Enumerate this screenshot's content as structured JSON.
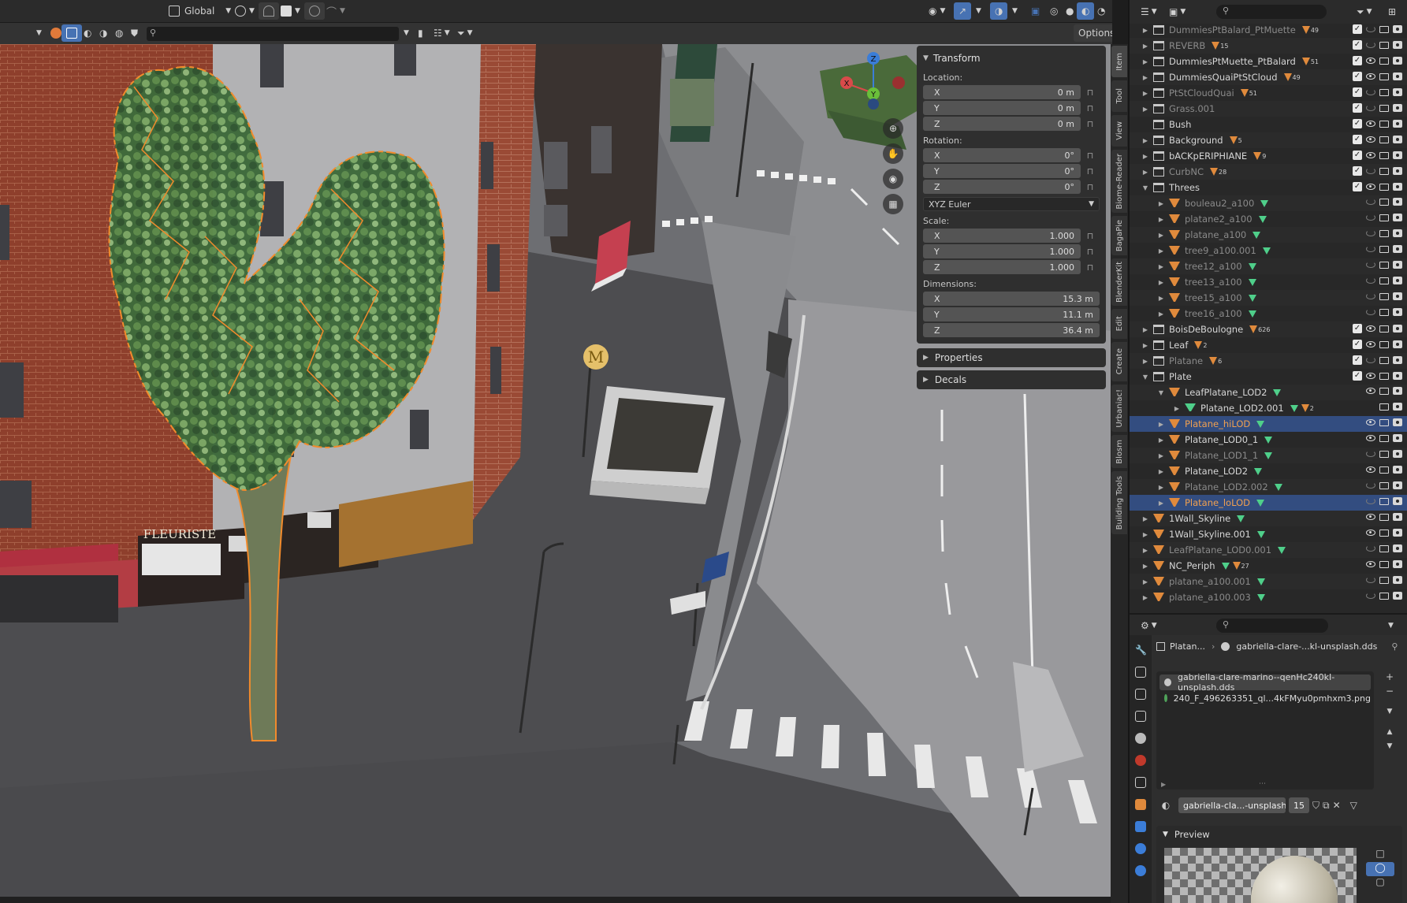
{
  "viewport_header": {
    "transform_orientation": "Global",
    "options_label": "Options"
  },
  "sign": {
    "fleuriste": "FLEURISTE",
    "metro": "M"
  },
  "gizmo": {
    "x": "X",
    "y": "Y",
    "z": "Z"
  },
  "npanel": {
    "transform_title": "Transform",
    "location_label": "Location:",
    "location": [
      {
        "axis": "X",
        "value": "0 m"
      },
      {
        "axis": "Y",
        "value": "0 m"
      },
      {
        "axis": "Z",
        "value": "0 m"
      }
    ],
    "rotation_label": "Rotation:",
    "rotation": [
      {
        "axis": "X",
        "value": "0°"
      },
      {
        "axis": "Y",
        "value": "0°"
      },
      {
        "axis": "Z",
        "value": "0°"
      }
    ],
    "rotation_mode": "XYZ Euler",
    "scale_label": "Scale:",
    "scale": [
      {
        "axis": "X",
        "value": "1.000"
      },
      {
        "axis": "Y",
        "value": "1.000"
      },
      {
        "axis": "Z",
        "value": "1.000"
      }
    ],
    "dimensions_label": "Dimensions:",
    "dimensions": [
      {
        "axis": "X",
        "value": "15.3 m"
      },
      {
        "axis": "Y",
        "value": "11.1 m"
      },
      {
        "axis": "Z",
        "value": "36.4 m"
      }
    ],
    "properties_title": "Properties",
    "decals_title": "Decals"
  },
  "sidebar_tabs": [
    "Item",
    "Tool",
    "View",
    "Biome-Reader",
    "BagaPie",
    "BlenderKit",
    "Edit",
    "Create",
    "Urbaniac!",
    "Blosm",
    "Building Tools"
  ],
  "outliner": {
    "rows": [
      {
        "name": "DummiesPtBalard_PtMuette",
        "badge": "49",
        "indent": 0,
        "icon": "collection",
        "dim": true,
        "check": true,
        "eye": false
      },
      {
        "name": "REVERB",
        "badge": "15",
        "indent": 0,
        "icon": "collection",
        "dim": true,
        "check": true,
        "eye": false
      },
      {
        "name": "DummiesPtMuette_PtBalard",
        "badge": "51",
        "indent": 0,
        "icon": "collection",
        "check": true,
        "eye": true
      },
      {
        "name": "DummiesQuaiPtStCloud",
        "badge": "49",
        "indent": 0,
        "icon": "collection",
        "check": true,
        "eye": true
      },
      {
        "name": "PtStCloudQuai",
        "badge": "51",
        "indent": 0,
        "icon": "collection",
        "dim": true,
        "check": true,
        "eye": false
      },
      {
        "name": "Grass.001",
        "badge": "",
        "indent": 0,
        "icon": "collection",
        "dim": true,
        "check": true,
        "eye": false
      },
      {
        "name": "Bush",
        "badge": "",
        "indent": 0,
        "icon": "collection",
        "check": true,
        "eye": true,
        "noexp": true
      },
      {
        "name": "Background",
        "badge": "5",
        "indent": 0,
        "icon": "collection",
        "check": true,
        "eye": true
      },
      {
        "name": "bACKpERIPHIANE",
        "badge": "9",
        "indent": 0,
        "icon": "collection",
        "check": true,
        "eye": true
      },
      {
        "name": "CurbNC",
        "badge": "28",
        "indent": 0,
        "icon": "collection",
        "dim": true,
        "check": true,
        "eye": false
      },
      {
        "name": "Threes",
        "badge": "",
        "indent": 0,
        "icon": "collection",
        "check": true,
        "eye": true,
        "open": true
      },
      {
        "name": "bouleau2_a100",
        "badge": "",
        "indent": 1,
        "icon": "object",
        "dim": true,
        "eye": false
      },
      {
        "name": "platane2_a100",
        "badge": "",
        "indent": 1,
        "icon": "object",
        "dim": true,
        "eye": false
      },
      {
        "name": "platane_a100",
        "badge": "",
        "indent": 1,
        "icon": "object",
        "dim": true,
        "eye": false
      },
      {
        "name": "tree9_a100.001",
        "badge": "",
        "indent": 1,
        "icon": "object",
        "dim": true,
        "eye": false
      },
      {
        "name": "tree12_a100",
        "badge": "",
        "indent": 1,
        "icon": "object",
        "dim": true,
        "eye": false
      },
      {
        "name": "tree13_a100",
        "badge": "",
        "indent": 1,
        "icon": "object",
        "dim": true,
        "eye": false
      },
      {
        "name": "tree15_a100",
        "badge": "",
        "indent": 1,
        "icon": "object",
        "dim": true,
        "eye": false
      },
      {
        "name": "tree16_a100",
        "badge": "",
        "indent": 1,
        "icon": "object",
        "dim": true,
        "eye": false
      },
      {
        "name": "BoisDeBoulogne",
        "badge": "626",
        "indent": 0,
        "icon": "collection",
        "check": true,
        "eye": true
      },
      {
        "name": "Leaf",
        "badge": "2",
        "indent": 0,
        "icon": "collection",
        "check": true,
        "eye": true
      },
      {
        "name": "Platane",
        "badge": "6",
        "indent": 0,
        "icon": "collection",
        "dim": true,
        "check": true,
        "eye": false
      },
      {
        "name": "Plate",
        "badge": "",
        "indent": 0,
        "icon": "collection",
        "check": true,
        "eye": true,
        "open": true
      },
      {
        "name": "LeafPlatane_LOD2",
        "badge": "",
        "indent": 1,
        "icon": "object",
        "eye": true,
        "open": true
      },
      {
        "name": "Platane_LOD2.001",
        "badge": "2",
        "indent": 2,
        "icon": "mesh",
        "eye": null
      },
      {
        "name": "Platane_hiLOD",
        "badge": "",
        "indent": 1,
        "icon": "object",
        "orange": true,
        "sel": true,
        "eye": true
      },
      {
        "name": "Platane_LOD0_1",
        "badge": "",
        "indent": 1,
        "icon": "object",
        "eye": true
      },
      {
        "name": "Platane_LOD1_1",
        "badge": "",
        "indent": 1,
        "icon": "object",
        "dim": true,
        "eye": false
      },
      {
        "name": "Platane_LOD2",
        "badge": "",
        "indent": 1,
        "icon": "object",
        "eye": true
      },
      {
        "name": "Platane_LOD2.002",
        "badge": "",
        "indent": 1,
        "icon": "object",
        "dim": true,
        "eye": false
      },
      {
        "name": "Platane_loLOD",
        "badge": "",
        "indent": 1,
        "icon": "object",
        "orange": true,
        "sel": true,
        "eye": false
      },
      {
        "name": "1Wall_Skyline",
        "badge": "",
        "indent": 0,
        "icon": "object",
        "eye": true
      },
      {
        "name": "1Wall_Skyline.001",
        "badge": "",
        "indent": 0,
        "icon": "object",
        "eye": true
      },
      {
        "name": "LeafPlatane_LOD0.001",
        "badge": "",
        "indent": 0,
        "icon": "object",
        "dim": true,
        "eye": false
      },
      {
        "name": "NC_Periph",
        "badge": "27",
        "indent": 0,
        "icon": "object",
        "eye": true
      },
      {
        "name": "platane_a100.001",
        "badge": "",
        "indent": 0,
        "icon": "object",
        "dim": true,
        "eye": false
      },
      {
        "name": "platane_a100.003",
        "badge": "",
        "indent": 0,
        "icon": "object",
        "dim": true,
        "eye": false
      }
    ]
  },
  "properties": {
    "breadcrumb_object": "Platan...",
    "breadcrumb_material": "gabriella-clare-...kl-unsplash.dds",
    "slots": [
      "gabriella-clare-marino--qenHc240kI-unsplash.dds",
      "240_F_496263351_ql...4kFMyu0pmhxm3.png"
    ],
    "material_name": "gabriella-cla...-unsplash.dds",
    "user_count": "15",
    "preview_label": "Preview"
  }
}
